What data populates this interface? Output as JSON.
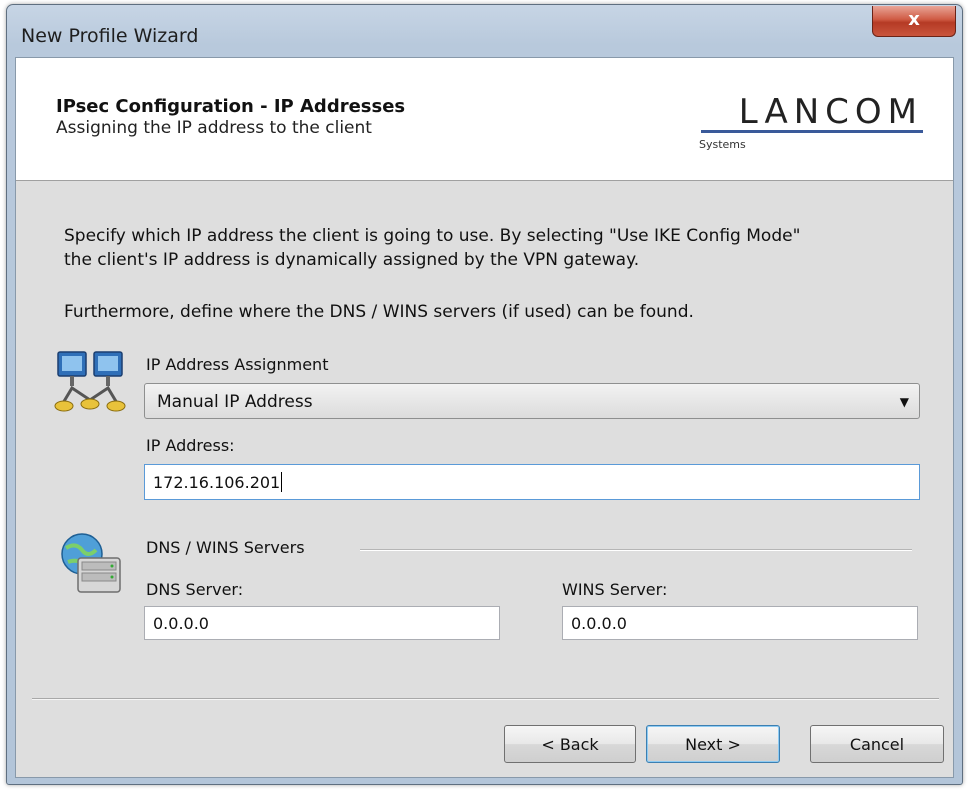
{
  "window": {
    "title": "New Profile Wizard",
    "close_label": "x"
  },
  "header": {
    "title": "IPsec Configuration - IP Addresses",
    "subtitle": "Assigning the IP address to the client",
    "logo_text": "LANCOM",
    "logo_sub": "Systems"
  },
  "instructions": {
    "line1": "Specify which IP address the client is going to use. By selecting \"Use IKE Config Mode\"",
    "line2": "the client's IP address is dynamically assigned by the VPN gateway.",
    "line3": "Furthermore, define where the DNS / WINS servers (if used) can be found."
  },
  "ip_assignment": {
    "label": "IP Address Assignment",
    "selected": "Manual IP Address"
  },
  "ip_address": {
    "label": "IP Address:",
    "value": "172.16.106.201"
  },
  "dns_wins": {
    "group_label": "DNS / WINS Servers",
    "dns_label": "DNS Server:",
    "dns_value": "0.0.0.0",
    "wins_label": "WINS Server:",
    "wins_value": "0.0.0.0"
  },
  "buttons": {
    "back": "< Back",
    "next": "Next >",
    "cancel": "Cancel"
  },
  "icons": {
    "network": "network-computers-icon",
    "server": "globe-server-icon",
    "dropdown": "chevron-down-icon"
  },
  "colors": {
    "accent": "#3a5a9a",
    "close": "#c8462f",
    "panel": "#dedede",
    "frame": "#b8c9dc"
  }
}
